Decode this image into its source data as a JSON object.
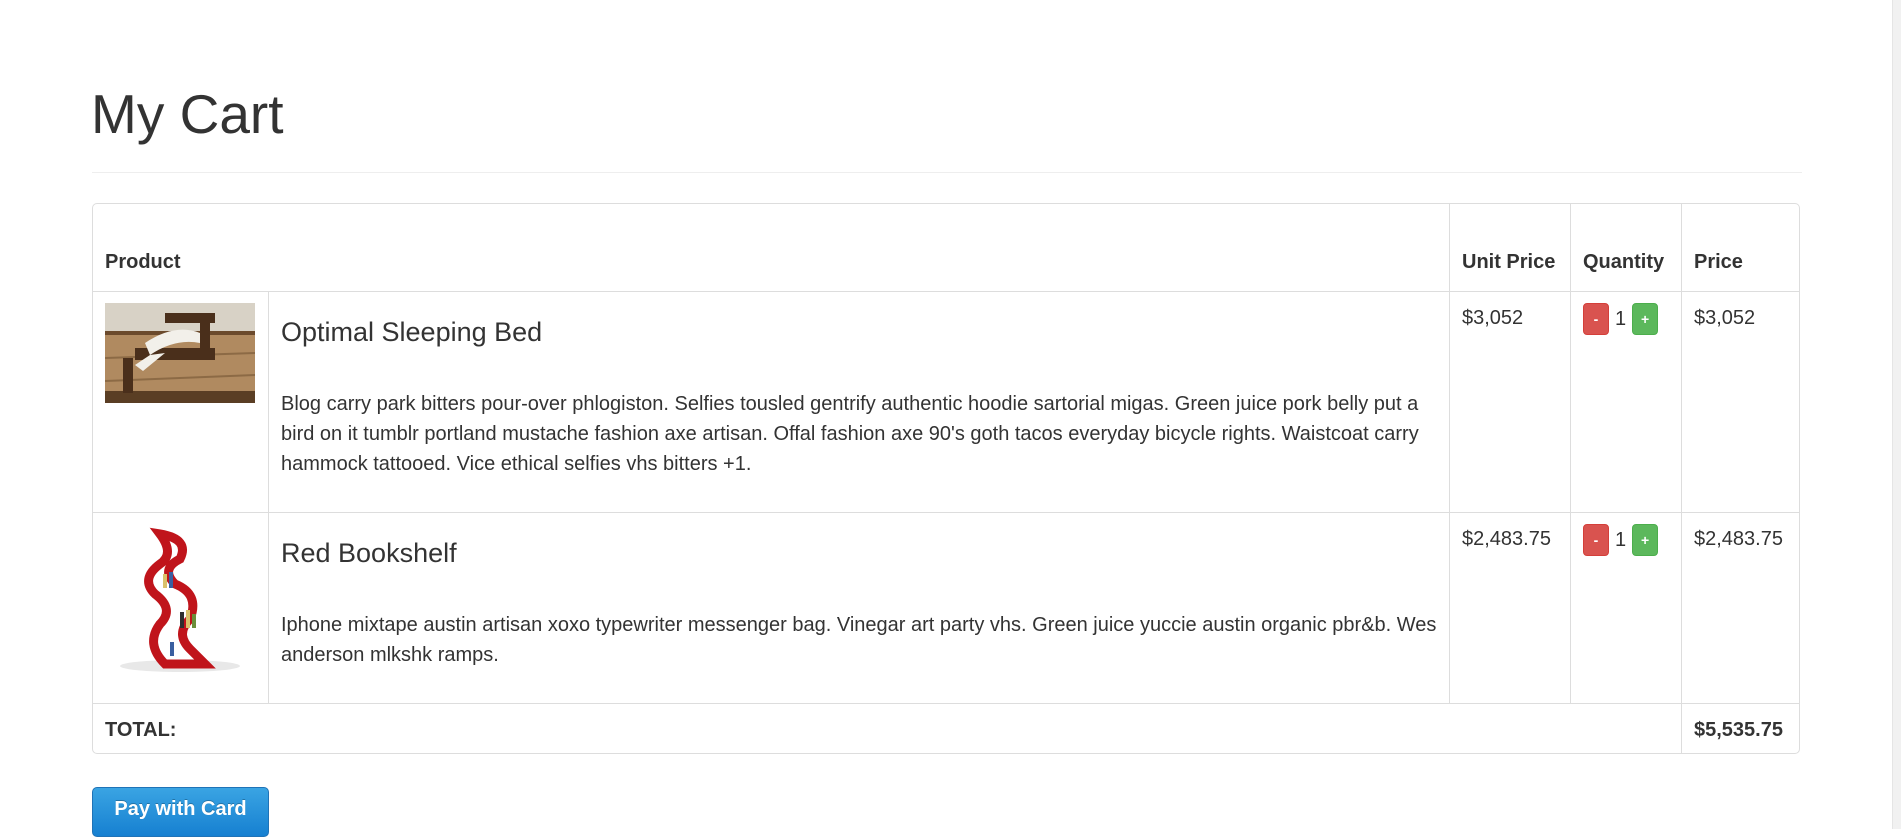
{
  "page": {
    "title": "My Cart"
  },
  "table": {
    "headers": {
      "product": "Product",
      "unit_price": "Unit Price",
      "quantity": "Quantity",
      "price": "Price"
    }
  },
  "items": [
    {
      "name": "Optimal Sleeping Bed",
      "description": "Blog carry park bitters pour-over phlogiston. Selfies tousled gentrify authentic hoodie sartorial migas. Green juice pork belly put a bird on it tumblr portland mustache fashion axe artisan. Offal fashion axe 90's goth tacos everyday bicycle rights. Waistcoat carry hammock tattooed. Vice ethical selfies vhs bitters +1.",
      "unit_price": "$3,052",
      "quantity": "1",
      "price": "$3,052",
      "minus_label": "-",
      "plus_label": "+"
    },
    {
      "name": "Red Bookshelf",
      "description": "Iphone mixtape austin artisan xoxo typewriter messenger bag. Vinegar art party vhs. Green juice yuccie austin organic pbr&b. Wes anderson mlkshk ramps.",
      "unit_price": "$2,483.75",
      "quantity": "1",
      "price": "$2,483.75",
      "minus_label": "-",
      "plus_label": "+"
    }
  ],
  "total": {
    "label": "TOTAL:",
    "value": "$5,535.75"
  },
  "actions": {
    "pay_label": "Pay with Card"
  },
  "colors": {
    "minus": "#d9534f",
    "plus": "#5cb85c",
    "pay": "#1f8dd6"
  }
}
